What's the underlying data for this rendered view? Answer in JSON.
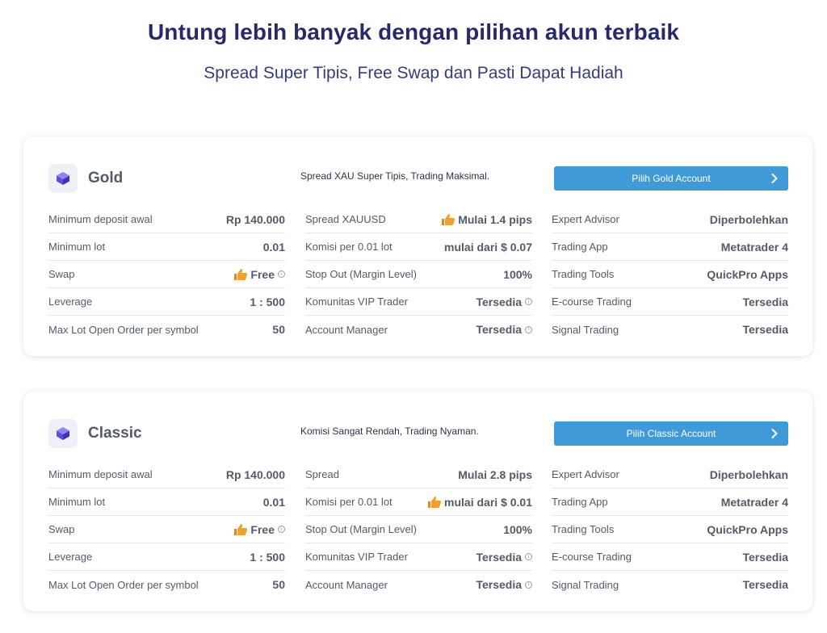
{
  "header": {
    "title": "Untung lebih banyak dengan pilihan akun terbaik",
    "subtitle": "Spread Super Tipis, Free Swap dan Pasti Dapat Hadiah"
  },
  "colors": {
    "title": "#262a6b",
    "button": "#3f9ad7",
    "thumb": "#f0a030",
    "logo": "#5b4fd6"
  },
  "cards": [
    {
      "name": "Gold",
      "tagline": "Spread XAU Super Tipis, Trading Maksimal.",
      "button": "Pilih Gold Account",
      "col1": [
        {
          "label": "Minimum deposit awal",
          "value": "Rp 140.000"
        },
        {
          "label": "Minimum lot",
          "value": "0.01"
        },
        {
          "label": "Swap",
          "value": "Free",
          "icon": "thumbs-up-icon",
          "info": true
        },
        {
          "label": "Leverage",
          "value": "1 : 500"
        },
        {
          "label": "Max Lot Open Order per symbol",
          "value": "50"
        }
      ],
      "col2": [
        {
          "label": "Spread XAUUSD",
          "value": "Mulai 1.4 pips",
          "icon": "thumbs-up-icon"
        },
        {
          "label": "Komisi per 0.01 lot",
          "value": "mulai dari $ 0.07"
        },
        {
          "label": "Stop Out (Margin Level)",
          "value": "100%"
        },
        {
          "label": "Komunitas VIP Trader",
          "value": "Tersedia",
          "info": true
        },
        {
          "label": "Account Manager",
          "value": "Tersedia",
          "info": true
        }
      ],
      "col3": [
        {
          "label": "Expert Advisor",
          "value": "Diperbolehkan"
        },
        {
          "label": "Trading App",
          "value": "Metatrader 4"
        },
        {
          "label": "Trading Tools",
          "value": "QuickPro Apps"
        },
        {
          "label": "E-course Trading",
          "value": "Tersedia"
        },
        {
          "label": "Signal Trading",
          "value": "Tersedia"
        }
      ]
    },
    {
      "name": "Classic",
      "tagline": "Komisi Sangat Rendah, Trading Nyaman.",
      "button": "Pilih Classic Account",
      "col1": [
        {
          "label": "Minimum deposit awal",
          "value": "Rp 140.000"
        },
        {
          "label": "Minimum lot",
          "value": "0.01"
        },
        {
          "label": "Swap",
          "value": "Free",
          "icon": "thumbs-up-icon",
          "info": true
        },
        {
          "label": "Leverage",
          "value": "1 : 500"
        },
        {
          "label": "Max Lot Open Order per symbol",
          "value": "50"
        }
      ],
      "col2": [
        {
          "label": "Spread",
          "value": "Mulai 2.8 pips"
        },
        {
          "label": "Komisi per 0.01 lot",
          "value": "mulai dari $ 0.01",
          "icon": "thumbs-up-icon"
        },
        {
          "label": "Stop Out (Margin Level)",
          "value": "100%"
        },
        {
          "label": "Komunitas VIP Trader",
          "value": "Tersedia",
          "info": true
        },
        {
          "label": "Account Manager",
          "value": "Tersedia",
          "info": true
        }
      ],
      "col3": [
        {
          "label": "Expert Advisor",
          "value": "Diperbolehkan"
        },
        {
          "label": "Trading App",
          "value": "Metatrader 4"
        },
        {
          "label": "Trading Tools",
          "value": "QuickPro Apps"
        },
        {
          "label": "E-course Trading",
          "value": "Tersedia"
        },
        {
          "label": "Signal Trading",
          "value": "Tersedia"
        }
      ]
    }
  ]
}
